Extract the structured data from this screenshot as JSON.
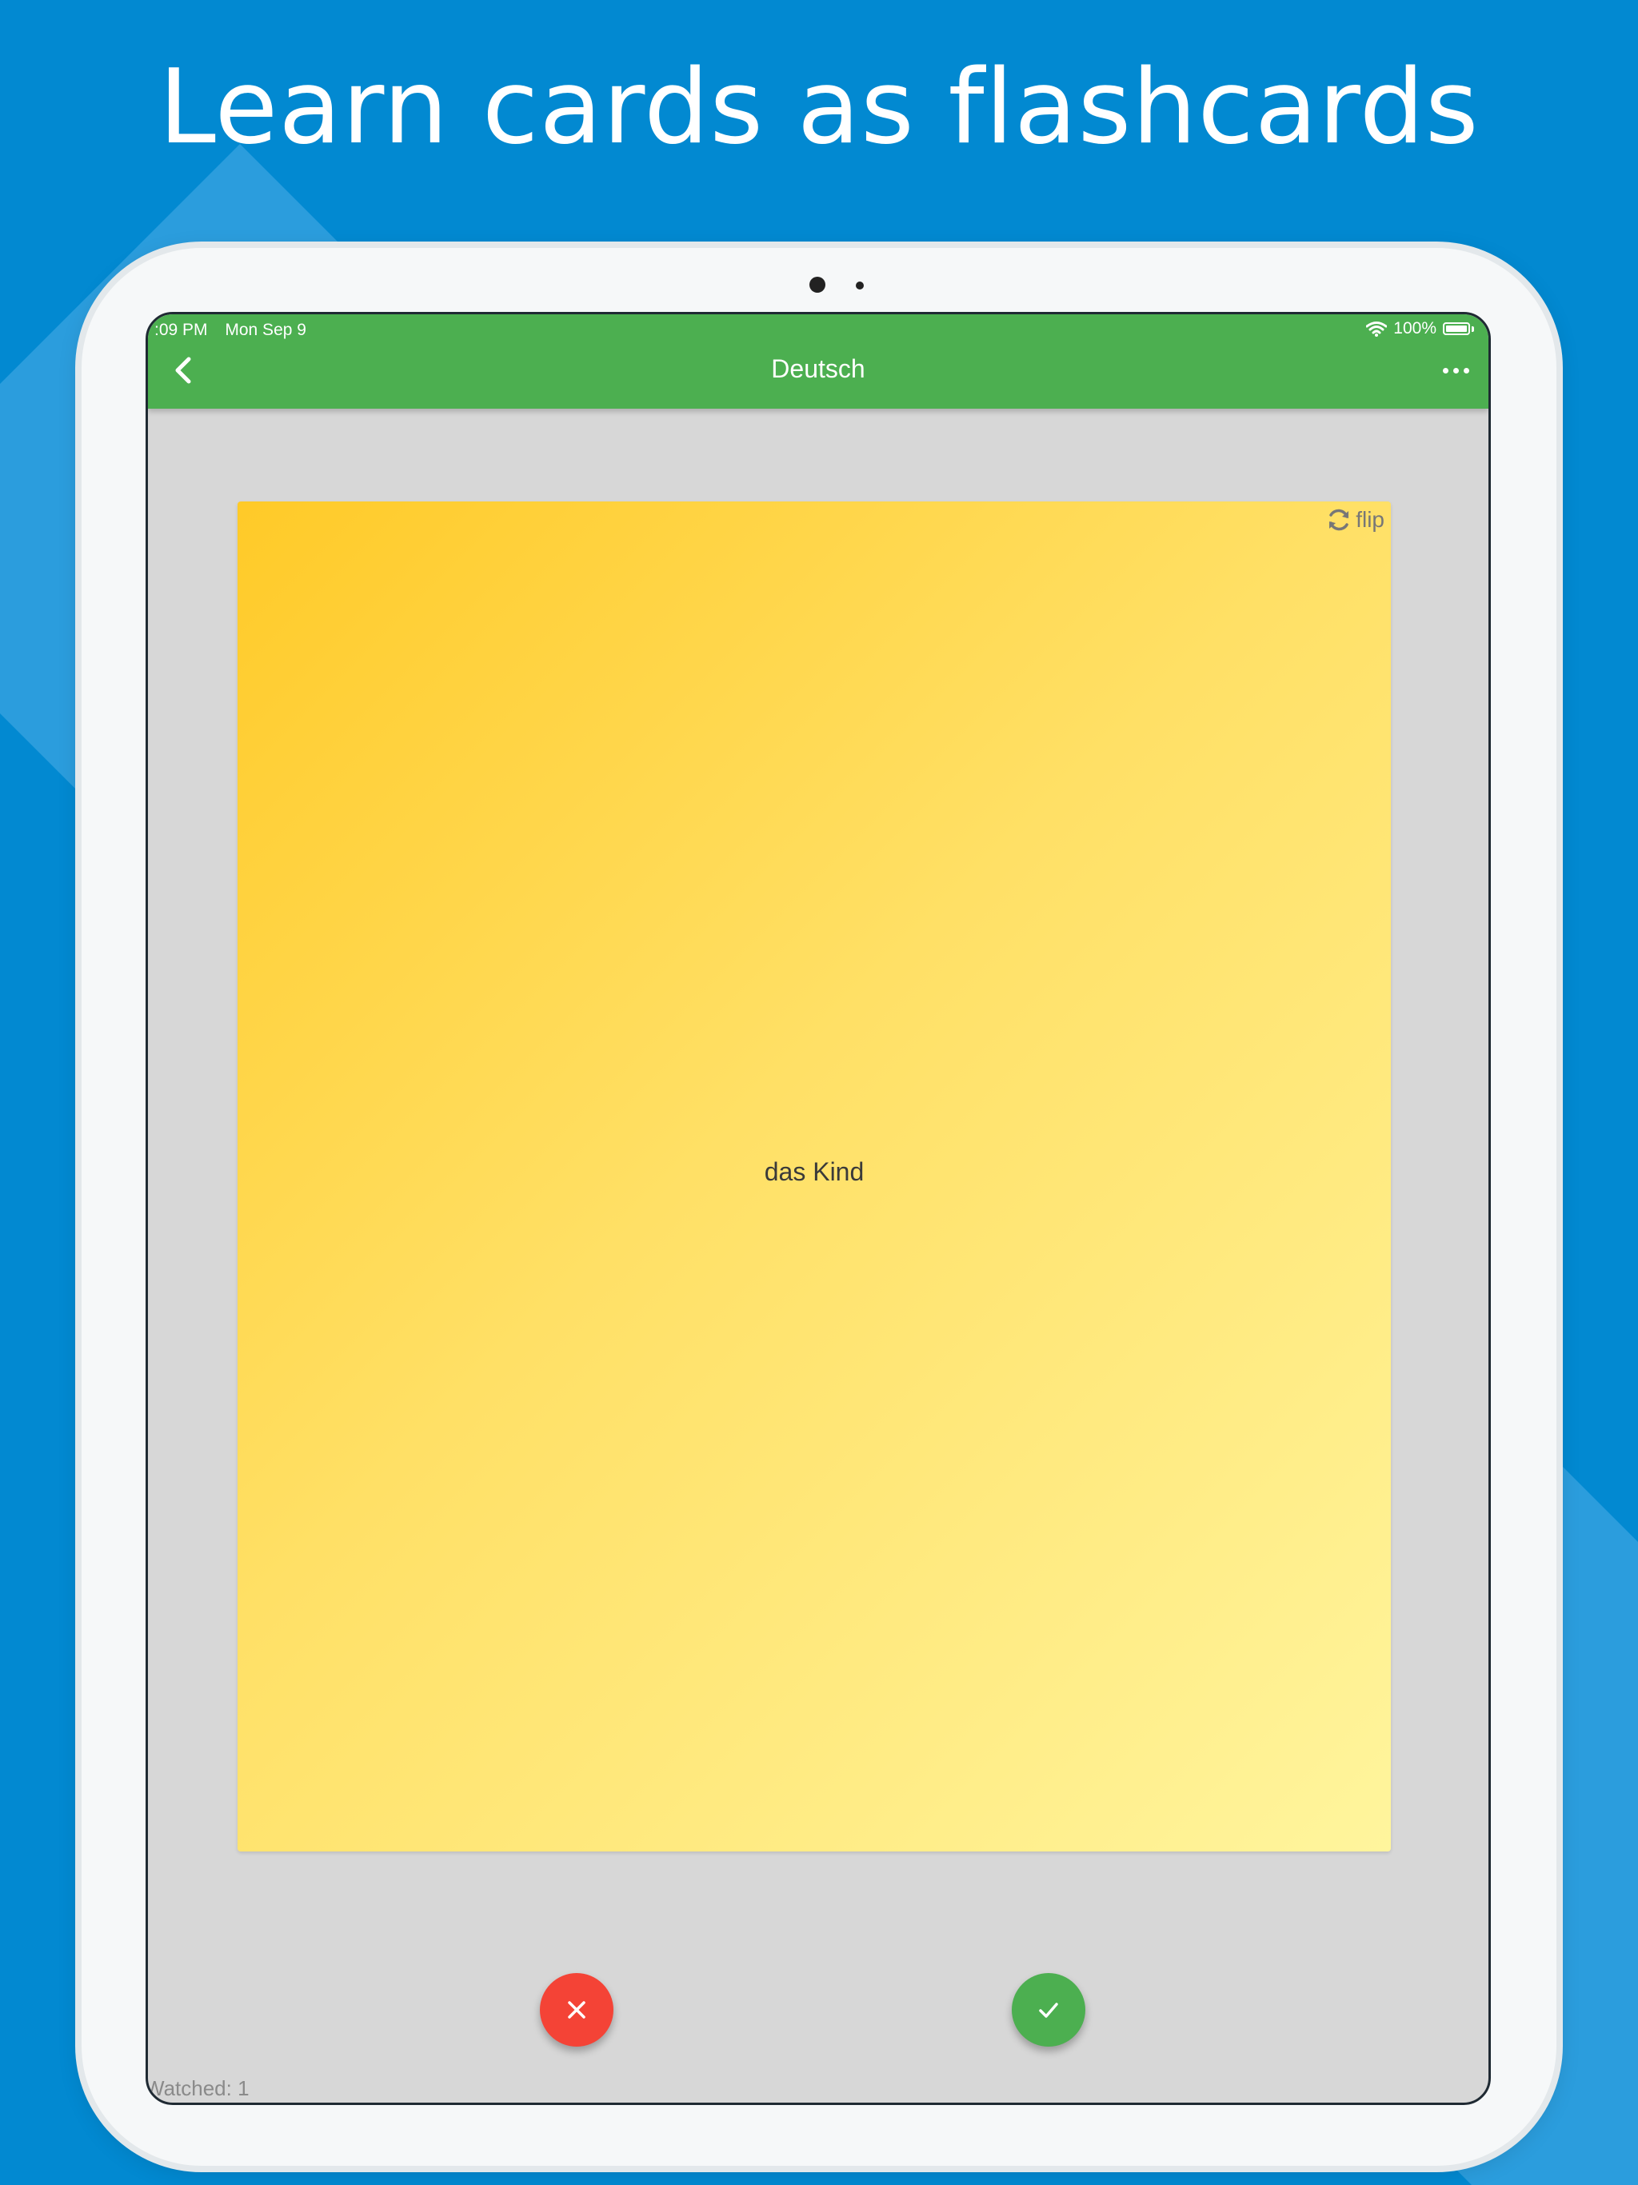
{
  "banner": {
    "headline": "Learn cards as flashcards"
  },
  "status_bar": {
    "time": ":09 PM",
    "date": "Mon Sep 9",
    "battery": "100%",
    "wifi_icon": "wifi-icon",
    "battery_icon": "battery-icon"
  },
  "appbar": {
    "title": "Deutsch",
    "back_icon": "chevron-left-icon",
    "more_icon": "more-horizontal-icon"
  },
  "card": {
    "text": "das Kind",
    "flip_label": "flip",
    "flip_icon": "refresh-icon"
  },
  "actions": {
    "wrong_icon": "close-icon",
    "right_icon": "check-icon"
  },
  "footer": {
    "watched": "Watched: 1"
  },
  "colors": {
    "background": "#0289d1",
    "appbar": "#4caf50",
    "wrong": "#f44336",
    "right": "#4caf50",
    "card_start": "#ffca28",
    "card_end": "#fff59d"
  }
}
